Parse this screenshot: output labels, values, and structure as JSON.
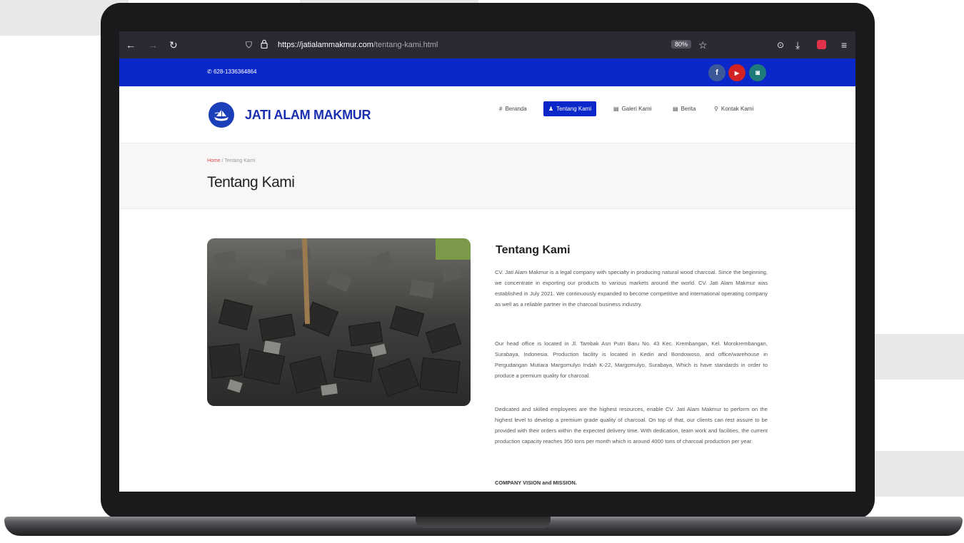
{
  "browser": {
    "url_host": "https://jatialammakmur.com",
    "url_path": "/tentang-kami.html",
    "zoom": "80%",
    "back_icon": "arrow-left-icon",
    "forward_icon": "arrow-right-icon",
    "reload_icon": "reload-icon",
    "shield_icon": "shield-icon",
    "lock_icon": "lock-icon",
    "star_icon": "star-icon",
    "pocket_icon": "pocket-icon",
    "download_icon": "download-icon",
    "menu_icon": "hamburger-menu-icon"
  },
  "topbar": {
    "phone": "628-1336364864",
    "bg_color": "#0b27c9",
    "social": [
      {
        "name": "facebook",
        "glyph": "f",
        "color": "#3b5998"
      },
      {
        "name": "youtube",
        "glyph": "▶",
        "color": "#d32222"
      },
      {
        "name": "instagram",
        "glyph": "◙",
        "color": "#1f7a7a"
      }
    ]
  },
  "header": {
    "logo_text": "JATI ALAM MAKMUR",
    "nav": [
      {
        "label": "Beranda",
        "icon": "#"
      },
      {
        "label": "Tentang Kami",
        "icon": "♟"
      },
      {
        "label": "Galeri Kami",
        "icon": "▤"
      },
      {
        "label": "Berita",
        "icon": "▤"
      },
      {
        "label": "Kontak Kami",
        "icon": "⚲"
      }
    ],
    "active_color": "#0b27c9"
  },
  "breadcrumb": {
    "home": "Home",
    "separator": " / ",
    "current": "Tentang Kami",
    "title": "Tentang Kami"
  },
  "content": {
    "title": "Tentang Kami",
    "paragraphs": [
      "CV. Jati Alam Makmur is a legal company with specialty in producing natural wood charcoal. Since the beginning, we concentrate in exporting our products to various markets around the world. CV. Jati Alam Makmur was established in July 2021. We continuously expanded to become competitive and international operating company as well as a reliable partner in the charcoal business industry.",
      "Our head office is located in Jl. Tambak Asri Putri Baru No. 43 Kec. Krembangan, Kel. Morokrembangan, Surabaya, Indonesia. Production facility is located in Kediri and Bondowoso, and office/warehouse in Pergudangan Mutiara Margomulyo Indah K-22, Margomulyo, Surabaya, Which is have standards in order to produce a premium quality for charcoal.",
      "Dedicated and skilled employees are the highest resources, enable CV. Jati Alam Makmur to perform on the highest level to develop a premium grade quality of charcoal. On top of that, our clients can rest assure to be provided with their orders within the expected delivery time. With dedication, team work and facilities, the current production capacity reaches 350 tons per month which is around 4000 tons of charcoal production per year."
    ],
    "vision_heading": "COMPANY VISION and MISSION."
  }
}
